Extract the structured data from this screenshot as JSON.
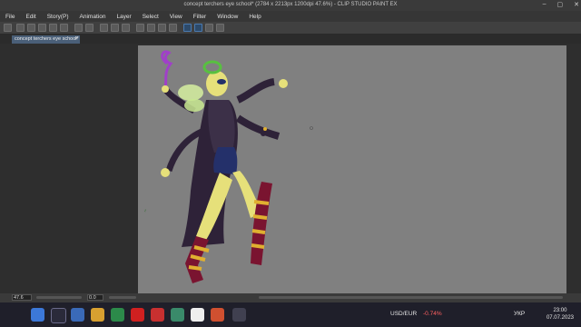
{
  "window": {
    "title": "concept terchers eye school* (2784 x 2213px 1200dpi 47.6%) - CLIP STUDIO PAINT EX",
    "min": "–",
    "max": "▢",
    "close": "✕"
  },
  "menu": [
    "File",
    "Edit",
    "Story(P)",
    "Animation",
    "Layer",
    "Select",
    "View",
    "Filter",
    "Window",
    "Help"
  ],
  "tab": {
    "label": "concept terchers eye school*",
    "close": "×"
  },
  "status": {
    "zoom": "47.6",
    "rotation": "0.0"
  },
  "canvas_bg": "#808080",
  "taskbar": {
    "tray_currency": "USD/EUR",
    "tray_change": "-0.74%",
    "tray_lang": "УКР",
    "time": "23:00",
    "date": "07.07.2023",
    "change_color": "#ff6060"
  }
}
